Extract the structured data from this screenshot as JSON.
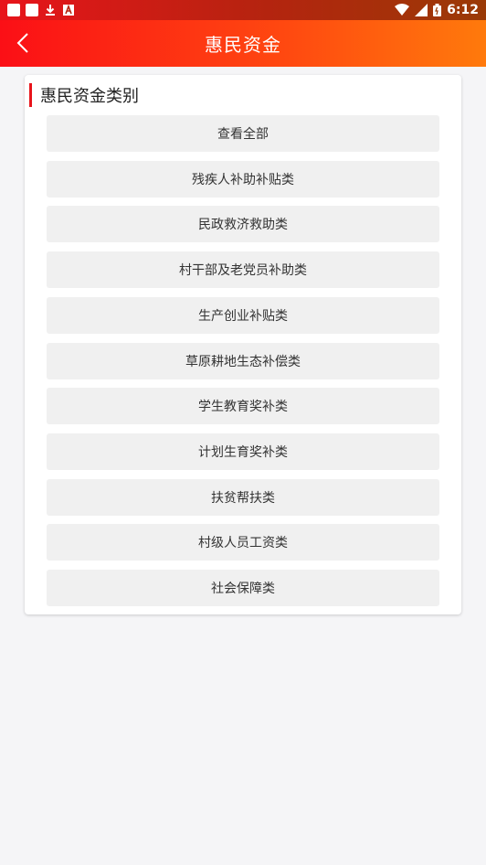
{
  "status_bar": {
    "time": "6:12",
    "icons": [
      "notification-square-icon",
      "notification-square-icon",
      "download-icon",
      "a-icon",
      "wifi-icon",
      "signal-icon",
      "battery-icon"
    ]
  },
  "header": {
    "title": "惠民资金",
    "back_icon": "chevron-left-icon",
    "gradient_start": "#fb0f16",
    "gradient_end": "#ff7a0c"
  },
  "card": {
    "title": "惠民资金类别",
    "accent": "#e8141b",
    "categories": [
      "查看全部",
      "残疾人补助补贴类",
      "民政救济救助类",
      "村干部及老党员补助类",
      "生产创业补贴类",
      "草原耕地生态补偿类",
      "学生教育奖补类",
      "计划生育奖补类",
      "扶贫帮扶类",
      "村级人员工资类",
      "社会保障类"
    ]
  }
}
